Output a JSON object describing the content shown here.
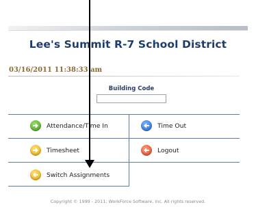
{
  "header": {
    "title": "Lee's Summit R-7 School District",
    "datetime": "03/16/2011 11:38:33 am"
  },
  "building_code": {
    "label": "Building Code",
    "value": ""
  },
  "buttons": {
    "attendance": {
      "label": "Attendance/Time In",
      "icon": "arrow-right-green-icon"
    },
    "time_out": {
      "label": "Time Out",
      "icon": "arrow-left-blue-icon"
    },
    "timesheet": {
      "label": "Timesheet",
      "icon": "arrow-right-yellow-icon"
    },
    "logout": {
      "label": "Logout",
      "icon": "arrow-left-red-icon"
    },
    "switch_assignments": {
      "label": "Switch Assignments",
      "icon": "arrow-left-yellow-icon"
    }
  },
  "footer": {
    "copyright": "Copyright © 1999 - 2011; WorkForce Software, Inc.  All rights reserved."
  },
  "colors": {
    "title": "#1f3c6e",
    "datetime": "#8c6a33",
    "grid_lines": "#5d7aa8"
  }
}
